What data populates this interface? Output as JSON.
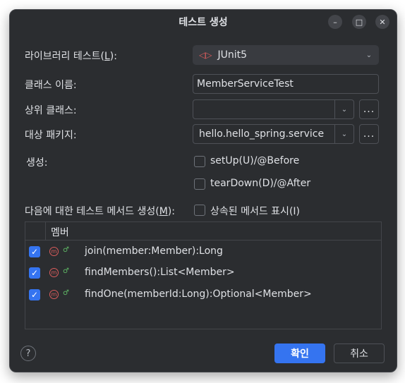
{
  "dialog": {
    "title": "테스트 생성",
    "window_buttons": {
      "minimize": "–",
      "maximize": "□",
      "close": "✕"
    }
  },
  "form": {
    "testing_library": {
      "label": "라이브러리 테스트(",
      "mnemonic": "L",
      "label_end": "):",
      "value": "JUnit5"
    },
    "class_name": {
      "label": "클래스 이름:",
      "value": "MemberServiceTest"
    },
    "superclass": {
      "label": "상위 클래스:",
      "value": ""
    },
    "target_package": {
      "label": "대상 패키지:",
      "value": "hello.hello_spring.service"
    },
    "generate": {
      "label": "생성:",
      "setup": {
        "label": "setUp(U)/@Before",
        "checked": false
      },
      "teardown": {
        "label": "tearDown(D)/@After",
        "checked": false
      }
    },
    "methods": {
      "label": "다음에 대한 테스트 메서드 생성(",
      "mnemonic": "M",
      "label_end": "):"
    },
    "show_inherited": {
      "label": "상속된 메서드 표시(I)",
      "checked": false
    }
  },
  "members_table": {
    "header": "멤버",
    "rows": [
      {
        "name": "join(member:Member):Long",
        "checked": true,
        "icon": "method-icon"
      },
      {
        "name": "findMembers():List<Member>",
        "checked": true,
        "icon": "method-icon"
      },
      {
        "name": "findOne(memberId:Long):Optional<Member>",
        "checked": true,
        "icon": "method-icon"
      }
    ]
  },
  "footer": {
    "ok": "확인",
    "cancel": "취소",
    "help": "?"
  },
  "colors": {
    "accent": "#3574f0",
    "background": "#2b2d30",
    "method_icon": "#db5c5c"
  }
}
